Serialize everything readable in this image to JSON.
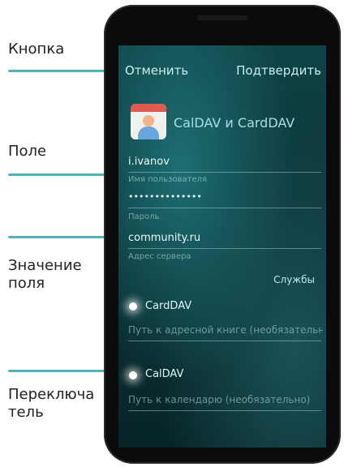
{
  "annotations": {
    "button": "Кнопка",
    "field": "Поле",
    "field_value": "Значение поля",
    "switch": "Переключатель"
  },
  "header": {
    "cancel_label": "Отменить",
    "confirm_label": "Подтвердить"
  },
  "app": {
    "title": "CalDAV и CardDAV"
  },
  "fields": {
    "username": {
      "value": "i.ivanov",
      "label": "Имя пользователя"
    },
    "password": {
      "value": "••••••••••••••",
      "label": "Пароль"
    },
    "server": {
      "value": "community.ru",
      "label": "Адрес сервера"
    }
  },
  "services_label": "Службы",
  "carddav": {
    "label": "CardDAV",
    "path_placeholder": "Путь к адресной книге (необязательно)"
  },
  "caldav": {
    "label": "CalDAV",
    "path_placeholder": "Путь к календарю (необязательно)"
  },
  "colors": {
    "accent": "#4fb3b9",
    "screen_bg": "#0f4347"
  }
}
